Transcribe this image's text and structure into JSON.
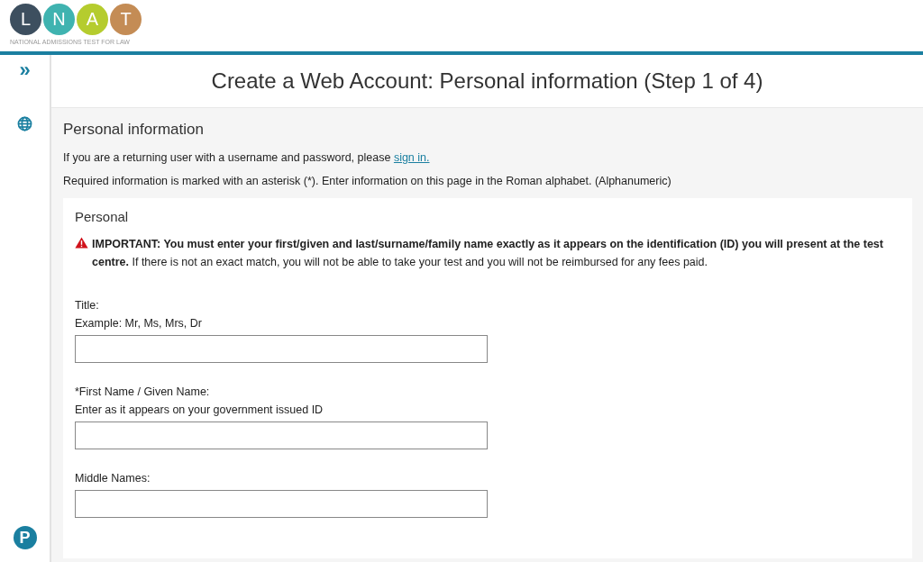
{
  "logo": {
    "letters": [
      {
        "letter": "L",
        "color": "#3d4f5f"
      },
      {
        "letter": "N",
        "color": "#3fb3b0"
      },
      {
        "letter": "A",
        "color": "#b5cc2e"
      },
      {
        "letter": "T",
        "color": "#c48c55"
      }
    ],
    "tagline": "NATIONAL ADMISSIONS TEST FOR LAW"
  },
  "sidebar": {
    "expand": "»",
    "brand": "P"
  },
  "page_title": "Create a Web Account: Personal information (Step 1 of 4)",
  "section": {
    "heading": "Personal information",
    "returning_text": "If you are a returning user with a username and password, please",
    "sign_in_link": "sign in.",
    "required_note": "Required information is marked with an asterisk (*). Enter information on this page in the Roman alphabet. (Alphanumeric)"
  },
  "card": {
    "heading": "Personal",
    "warning": "**IMPORTANT: You must enter your first/given and last/surname/family name exactly as it appears on the identification (ID) you will present at the test centre.** If there is not an exact match, you will not be able to take your test and you will not be reimbursed for any fees paid.",
    "fields": [
      {
        "label": "Title:",
        "hint": "Example: Mr, Ms, Mrs, Dr"
      },
      {
        "label": "*First Name / Given Name:",
        "hint": "Enter as it appears on your government issued ID"
      },
      {
        "label": "Middle Names:"
      }
    ]
  }
}
